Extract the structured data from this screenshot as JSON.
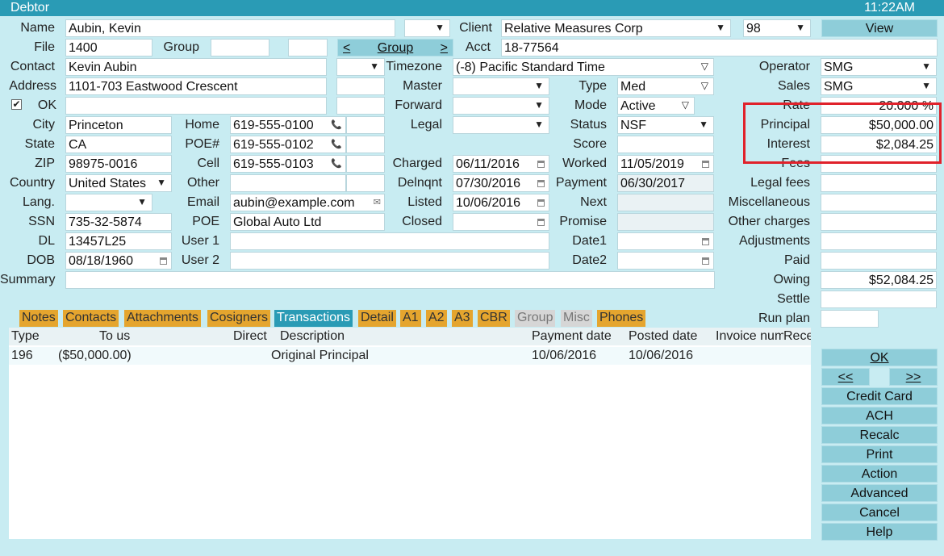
{
  "window": {
    "title": "Debtor",
    "clock": "11:22AM"
  },
  "labels": {
    "name": "Name",
    "file": "File",
    "group": "Group",
    "contact": "Contact",
    "address": "Address",
    "ok": "OK",
    "city": "City",
    "state": "State",
    "zip": "ZIP",
    "country": "Country",
    "lang": "Lang.",
    "ssn": "SSN",
    "dl": "DL",
    "dob": "DOB",
    "summary": "Summary",
    "home": "Home",
    "poe_num": "POE#",
    "cell": "Cell",
    "other": "Other",
    "email": "Email",
    "poe": "POE",
    "user1": "User 1",
    "user2": "User 2",
    "client": "Client",
    "acct": "Acct",
    "timezone": "Timezone",
    "master": "Master",
    "forward": "Forward",
    "legal": "Legal",
    "charged": "Charged",
    "delnqnt": "Delnqnt",
    "listed": "Listed",
    "closed": "Closed",
    "type": "Type",
    "mode": "Mode",
    "status": "Status",
    "score": "Score",
    "worked": "Worked",
    "payment": "Payment",
    "next": "Next",
    "promise": "Promise",
    "date1": "Date1",
    "date2": "Date2",
    "operator": "Operator",
    "sales": "Sales",
    "rate": "Rate",
    "principal": "Principal",
    "interest": "Interest",
    "fees": "Fees",
    "legal_fees": "Legal fees",
    "misc": "Miscellaneous",
    "other_charges": "Other charges",
    "adjustments": "Adjustments",
    "paid": "Paid",
    "owing": "Owing",
    "settle": "Settle",
    "run_plan": "Run plan"
  },
  "fields": {
    "name": "Aubin, Kevin",
    "file": "1400",
    "contact": "Kevin Aubin",
    "address": "1101-703 Eastwood Crescent",
    "city": "Princeton",
    "state": "CA",
    "zip": "98975-0016",
    "country": "United States",
    "ssn": "735-32-5874",
    "dl": "13457L25",
    "dob": "08/18/1960",
    "home": "619-555-0100",
    "poe_num": "619-555-0102",
    "cell": "619-555-0103",
    "email": "aubin@example.com",
    "poe": "Global Auto Ltd",
    "client": "Relative Measures Corp",
    "client_code": "98",
    "acct": "18-77564",
    "timezone": "(-8) Pacific Standard Time",
    "charged": "06/11/2016",
    "delnqnt": "07/30/2016",
    "listed": "10/06/2016",
    "type": "Med",
    "mode": "Active",
    "status": "NSF",
    "worked": "11/05/2019",
    "payment": "06/30/2017",
    "operator": "SMG",
    "sales": "SMG",
    "rate": "20.000 %",
    "principal": "$50,000.00",
    "interest": "$2,084.25",
    "owing": "$52,084.25"
  },
  "buttons": {
    "view": "View",
    "group_prev": "<",
    "group": "Group",
    "group_next": ">",
    "ok": "OK",
    "prev": "<<",
    "next": ">>",
    "credit_card": "Credit Card",
    "ach": "ACH",
    "recalc": "Recalc",
    "print": "Print",
    "action": "Action",
    "advanced": "Advanced",
    "cancel": "Cancel",
    "help": "Help"
  },
  "tabs": [
    "Notes",
    "Contacts",
    "Attachments",
    "Cosigners",
    "Transactions",
    "Detail",
    "A1",
    "A2",
    "A3",
    "CBR",
    "Group",
    "Misc",
    "Phones"
  ],
  "grid": {
    "columns": [
      "Type",
      "To us",
      "Direct",
      "Description",
      "Payment date",
      "Posted date",
      "Invoice num",
      "Rece"
    ],
    "rows": [
      [
        "196",
        "($50,000.00)",
        "",
        "Original Principal",
        "10/06/2016",
        "10/06/2016",
        "",
        ""
      ]
    ]
  },
  "colors": {
    "titlebar": "#2a9bb5",
    "background": "#c8ecf2",
    "tab": "#e5a52e",
    "tab_active": "#2a9bb5",
    "highlight": "#e0222b"
  }
}
